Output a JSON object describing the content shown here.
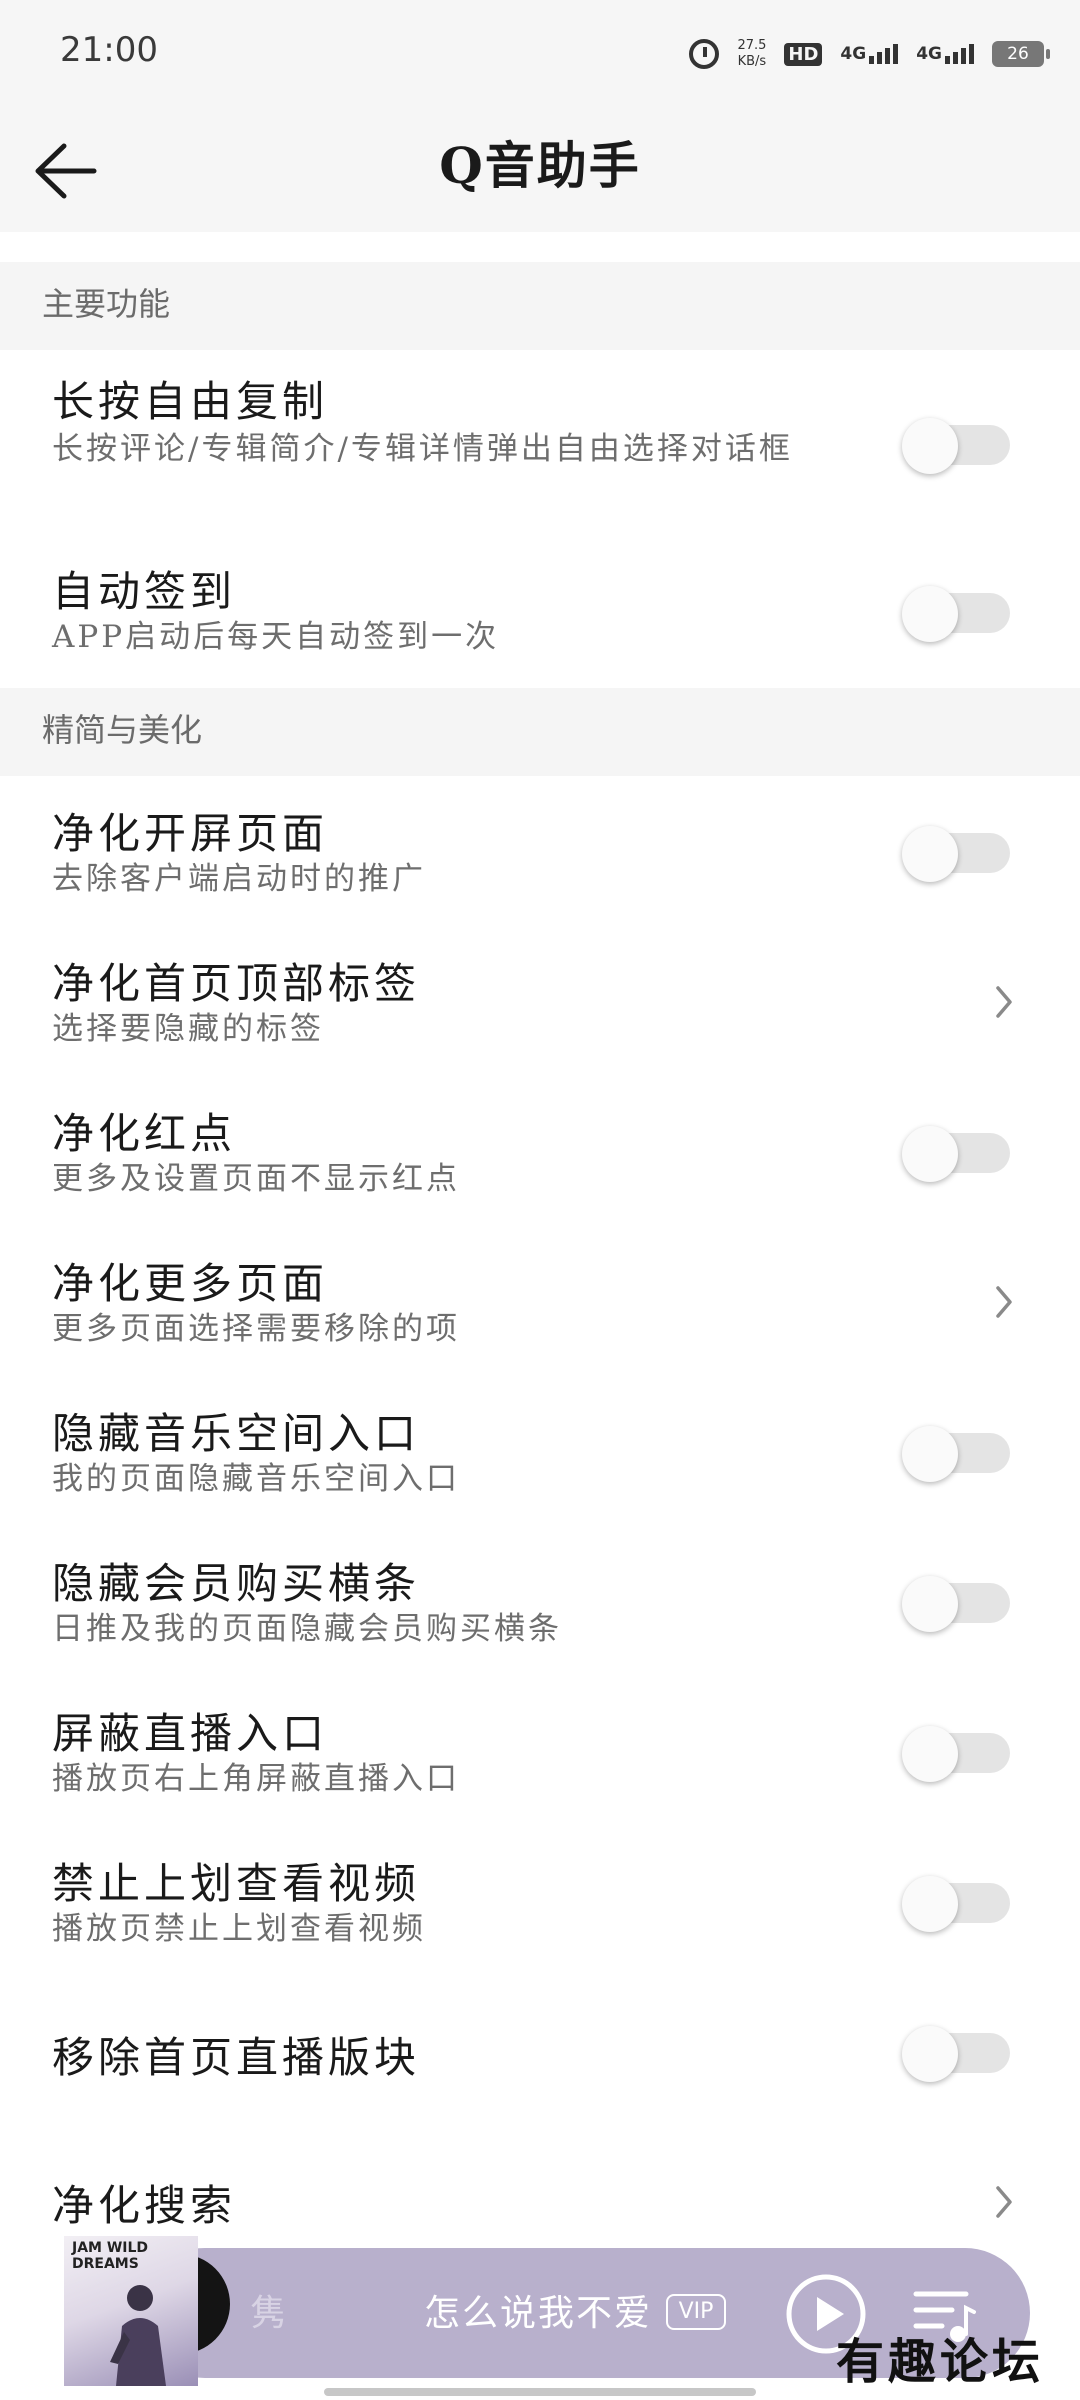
{
  "status": {
    "time": "21:00",
    "speed_value": "27.5",
    "speed_unit": "KB/s",
    "hd": "HD",
    "sim1": "4G",
    "sim2": "4G",
    "battery": "26"
  },
  "header": {
    "title": "Q音助手"
  },
  "sections": [
    {
      "label": "主要功能"
    },
    {
      "label": "精简与美化"
    }
  ],
  "rows": [
    {
      "title": "长按自由复制",
      "subtitle": "长按评论/专辑简介/专辑详情弹出自由选择对话框",
      "control": "toggle",
      "on": false
    },
    {
      "title": "自动签到",
      "subtitle": "APP启动后每天自动签到一次",
      "control": "toggle",
      "on": false
    },
    {
      "title": "净化开屏页面",
      "subtitle": "去除客户端启动时的推广",
      "control": "toggle",
      "on": false
    },
    {
      "title": "净化首页顶部标签",
      "subtitle": "选择要隐藏的标签",
      "control": "chevron"
    },
    {
      "title": "净化红点",
      "subtitle": "更多及设置页面不显示红点",
      "control": "toggle",
      "on": false
    },
    {
      "title": "净化更多页面",
      "subtitle": "更多页面选择需要移除的项",
      "control": "chevron"
    },
    {
      "title": "隐藏音乐空间入口",
      "subtitle": "我的页面隐藏音乐空间入口",
      "control": "toggle",
      "on": false
    },
    {
      "title": "隐藏会员购买横条",
      "subtitle": "日推及我的页面隐藏会员购买横条",
      "control": "toggle",
      "on": false
    },
    {
      "title": "屏蔽直播入口",
      "subtitle": "播放页右上角屏蔽直播入口",
      "control": "toggle",
      "on": false
    },
    {
      "title": "禁止上划查看视频",
      "subtitle": "播放页禁止上划查看视频",
      "control": "toggle",
      "on": false
    },
    {
      "title": "移除首页直播版块",
      "subtitle": "",
      "control": "toggle",
      "on": false
    },
    {
      "title": "净化搜索",
      "subtitle": "",
      "control": "chevron"
    }
  ],
  "player": {
    "album_text": "JAM WILD DREAMS",
    "prev_fragment": "隽",
    "song": "怎么说我不爱",
    "badge": "VIP"
  },
  "watermark": "有趣论坛"
}
